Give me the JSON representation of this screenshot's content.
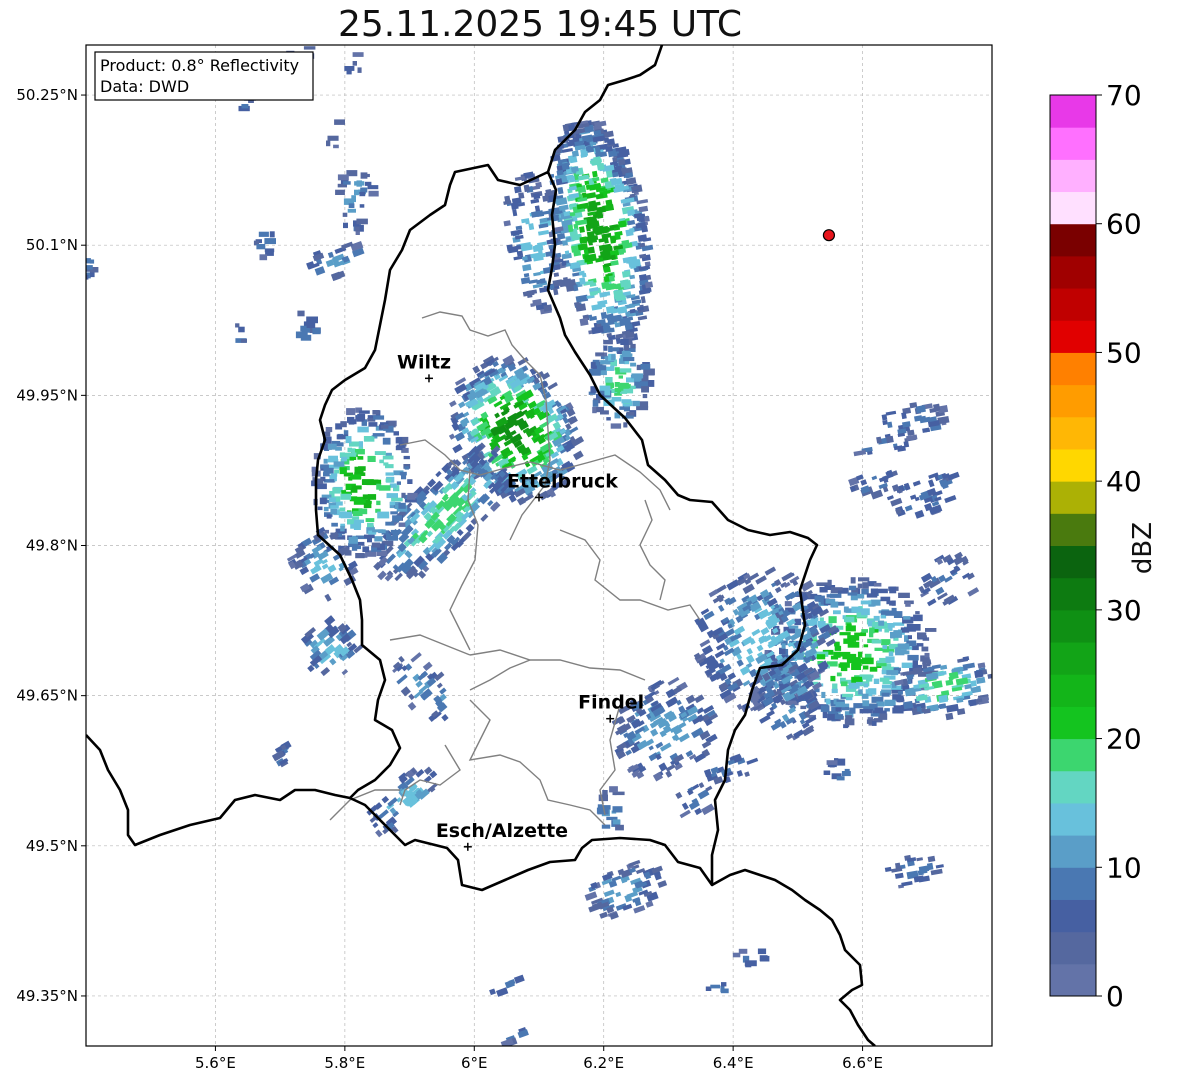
{
  "title": "25.11.2025 19:45 UTC",
  "info_box": {
    "product": "Product: 0.8° Reflectivity",
    "data": "Data: DWD"
  },
  "map": {
    "lon_range": [
      5.4,
      6.8
    ],
    "lat_range": [
      49.3,
      50.3
    ],
    "lon_ticks": [
      {
        "value": 5.6,
        "label": "5.6°E"
      },
      {
        "value": 5.8,
        "label": "5.8°E"
      },
      {
        "value": 6.0,
        "label": "6°E"
      },
      {
        "value": 6.2,
        "label": "6.2°E"
      },
      {
        "value": 6.4,
        "label": "6.4°E"
      },
      {
        "value": 6.6,
        "label": "6.6°E"
      }
    ],
    "lat_ticks": [
      {
        "value": 50.25,
        "label": "50.25°N"
      },
      {
        "value": 50.1,
        "label": "50.1°N"
      },
      {
        "value": 49.95,
        "label": "49.95°N"
      },
      {
        "value": 49.8,
        "label": "49.8°N"
      },
      {
        "value": 49.65,
        "label": "49.65°N"
      },
      {
        "value": 49.5,
        "label": "49.5°N"
      },
      {
        "value": 49.35,
        "label": "49.35°N"
      }
    ],
    "cities": [
      {
        "name": "Wiltz",
        "lon": 5.93,
        "lat": 49.967
      },
      {
        "name": "Ettelbruck",
        "lon": 6.1,
        "lat": 49.848
      },
      {
        "name": "Findel",
        "lon": 6.21,
        "lat": 49.627
      },
      {
        "name": "Esch/Alzette",
        "lon": 5.99,
        "lat": 49.499
      }
    ],
    "radar_site": {
      "lon": 6.548,
      "lat": 50.11,
      "color": "#e8141c"
    }
  },
  "colorbar": {
    "label": "dBZ",
    "min": 0,
    "max": 70,
    "tick_values": [
      0,
      10,
      20,
      30,
      40,
      50,
      60,
      70
    ],
    "colors": [
      "#6373a8",
      "#55689f",
      "#4660a2",
      "#4a78b2",
      "#5a9ec8",
      "#68c1dc",
      "#63d6c2",
      "#3cd66f",
      "#14c41f",
      "#13b519",
      "#12a417",
      "#0f9014",
      "#0d7b11",
      "#0b640f",
      "#4a7a0e",
      "#acb105",
      "#ffd700",
      "#ffb705",
      "#ff9c00",
      "#ff8000",
      "#e10000",
      "#c00000",
      "#a00000",
      "#7a0000",
      "#ffe0ff",
      "#ffb0ff",
      "#ff70ff",
      "#e839e8"
    ]
  }
}
